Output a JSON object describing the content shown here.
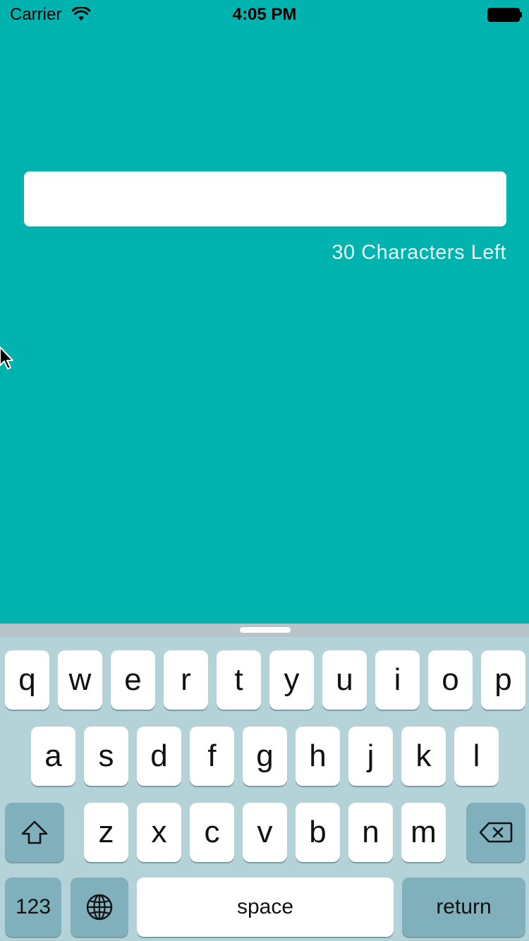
{
  "status_bar": {
    "carrier": "Carrier",
    "time": "4:05 PM"
  },
  "text_field": {
    "value": "",
    "placeholder": ""
  },
  "char_counter": "30 Characters Left",
  "keyboard": {
    "row1": [
      "q",
      "w",
      "e",
      "r",
      "t",
      "y",
      "u",
      "i",
      "o",
      "p"
    ],
    "row2": [
      "a",
      "s",
      "d",
      "f",
      "g",
      "h",
      "j",
      "k",
      "l"
    ],
    "row3": [
      "z",
      "x",
      "c",
      "v",
      "b",
      "n",
      "m"
    ],
    "numbers_label": "123",
    "space_label": "space",
    "return_label": "return"
  },
  "colors": {
    "background": "#00B3AE",
    "keyboard_bg": "#B3D3D9",
    "dark_key": "#7FB0BB"
  }
}
